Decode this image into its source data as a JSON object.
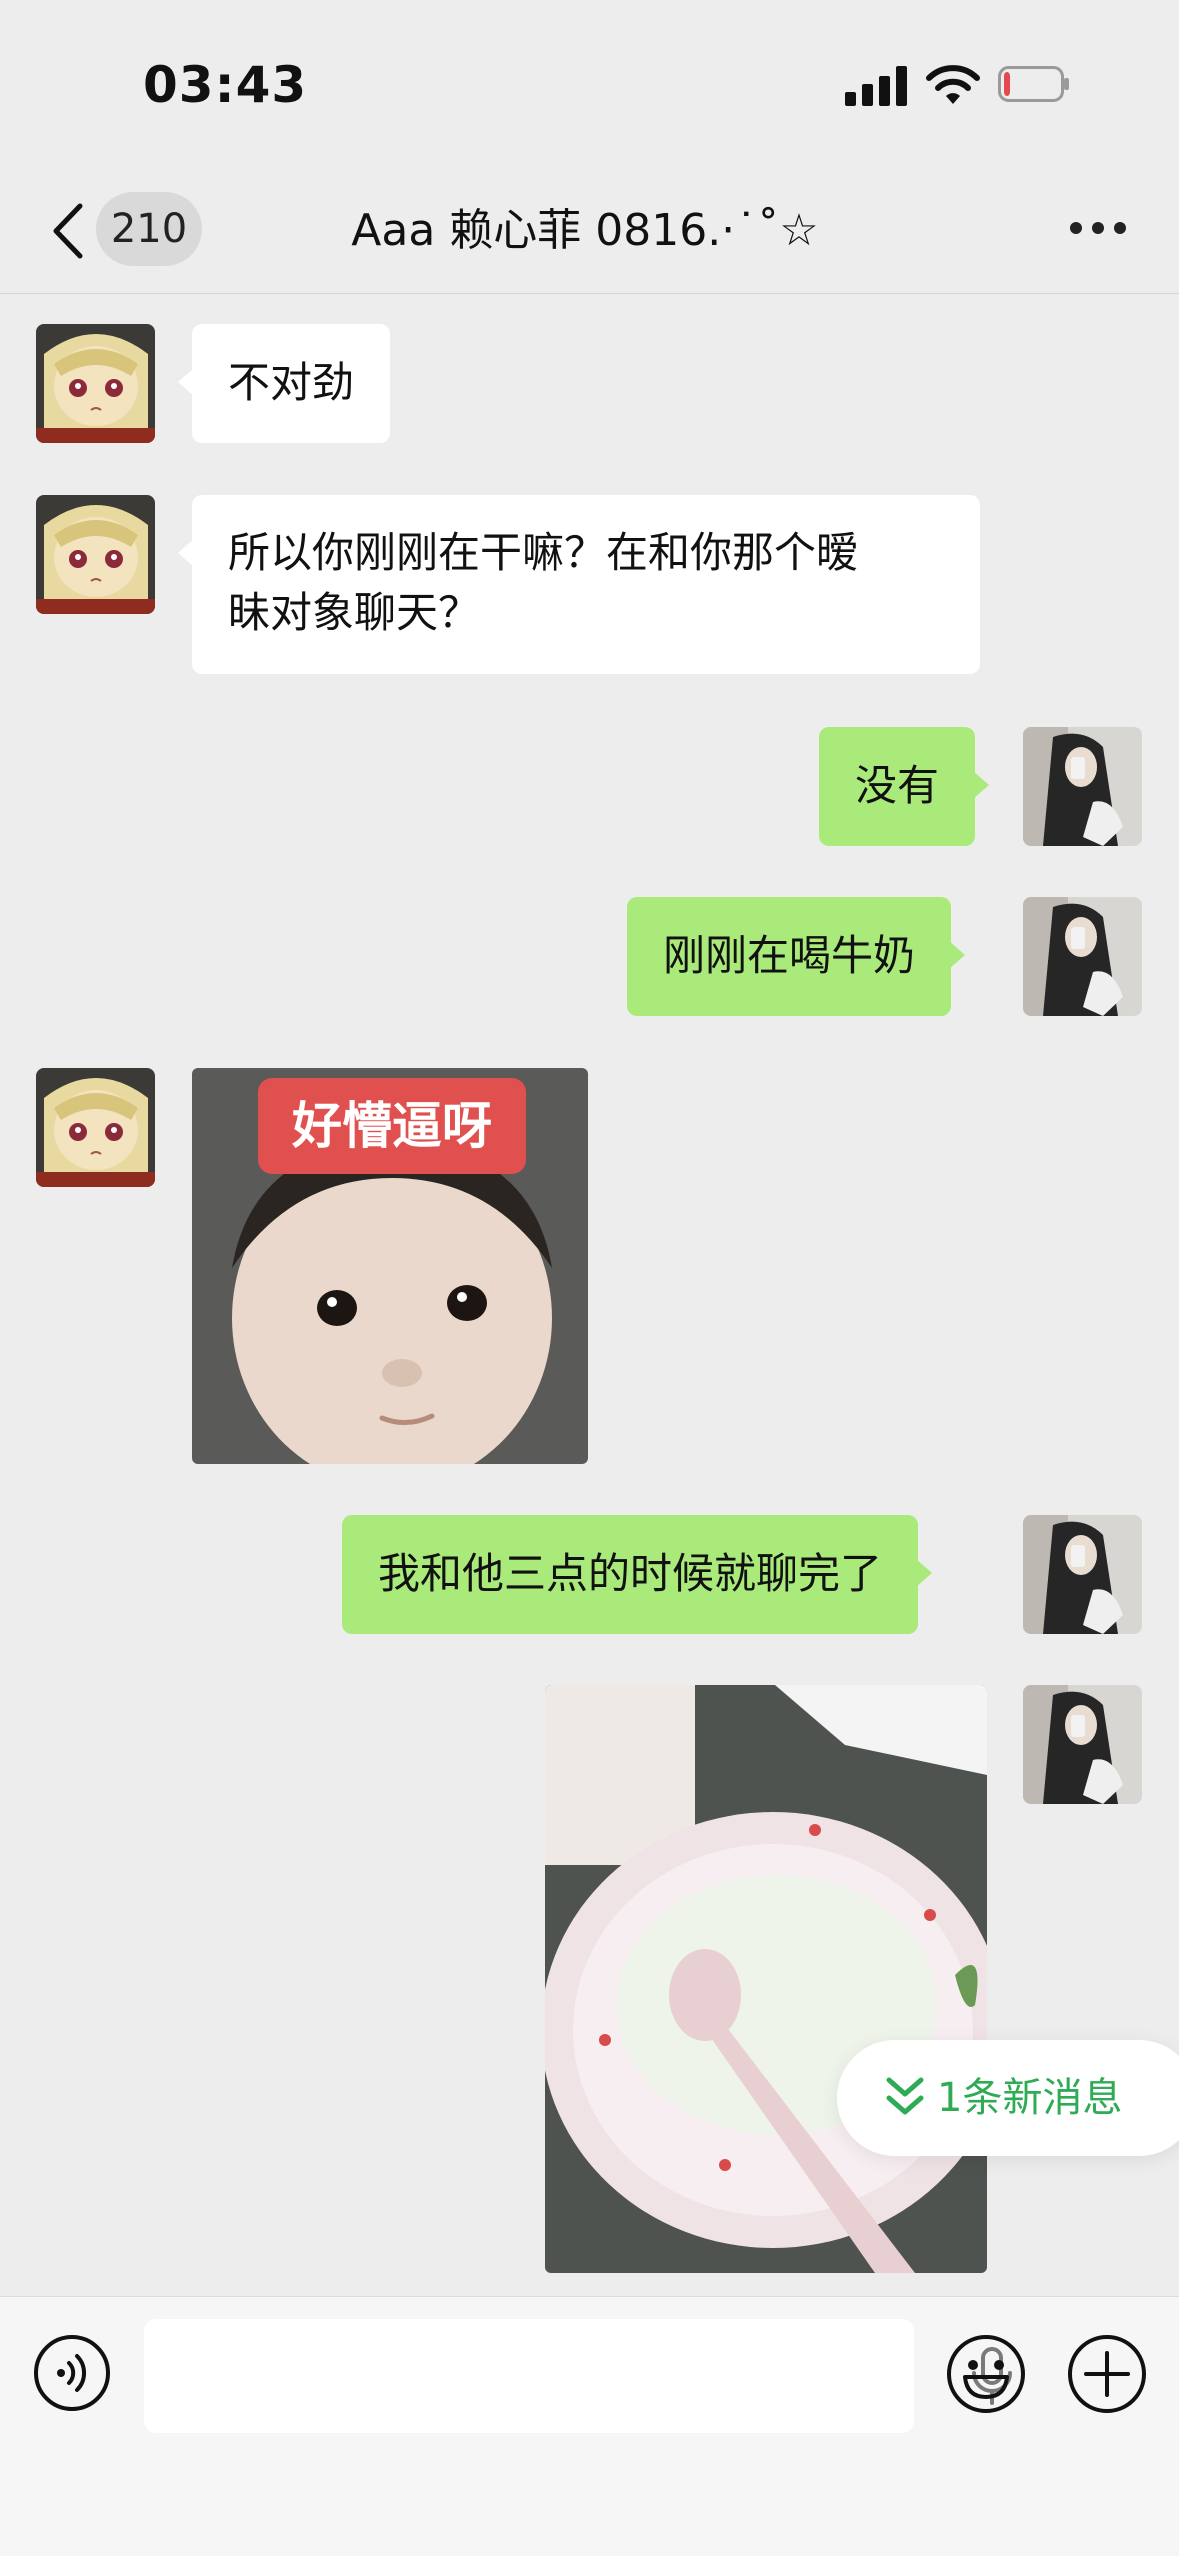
{
  "status_bar": {
    "time": "03:43",
    "signal_icon": "signal-bars-icon",
    "wifi_icon": "wifi-icon",
    "battery_icon": "battery-low-icon",
    "battery_level": 0.12,
    "battery_color": "#e5484d"
  },
  "header": {
    "back_icon": "chevron-left-icon",
    "unread_count": "210",
    "title": "Aaa 赖心菲 0816.⋅˙˚☆",
    "more_icon": "ellipsis-icon"
  },
  "messages": [
    {
      "side": "in",
      "type": "text",
      "text": "不对劲",
      "avatar": "anime-girl-avatar"
    },
    {
      "side": "in",
      "type": "text",
      "lines": [
        "所以你刚刚在干嘛？在和你那个暧",
        "昧对象聊天？"
      ],
      "avatar": "anime-girl-avatar"
    },
    {
      "side": "out",
      "type": "text",
      "text": "没有",
      "avatar": "selfie-avatar"
    },
    {
      "side": "out",
      "type": "text",
      "text": "刚刚在喝牛奶",
      "avatar": "selfie-avatar"
    },
    {
      "side": "in",
      "type": "sticker",
      "caption": "好懵逼呀",
      "avatar": "anime-girl-avatar"
    },
    {
      "side": "out",
      "type": "text",
      "text": "我和他三点的时候就聊完了",
      "avatar": "selfie-avatar"
    },
    {
      "side": "out",
      "type": "image",
      "description_icon": "milk-bowl-photo",
      "avatar": "selfie-avatar"
    }
  ],
  "new_message_pill": {
    "text": "1条新消息",
    "icon": "double-chevron-down-icon",
    "color": "#2faa55"
  },
  "input_bar": {
    "voice_icon": "voice-mode-icon",
    "mic_icon": "microphone-icon",
    "emoji_icon": "emoji-icon",
    "plus_icon": "plus-circle-icon"
  },
  "colors": {
    "background": "#ededed",
    "outgoing_bubble": "#a9ea7a",
    "incoming_bubble": "#ffffff"
  }
}
